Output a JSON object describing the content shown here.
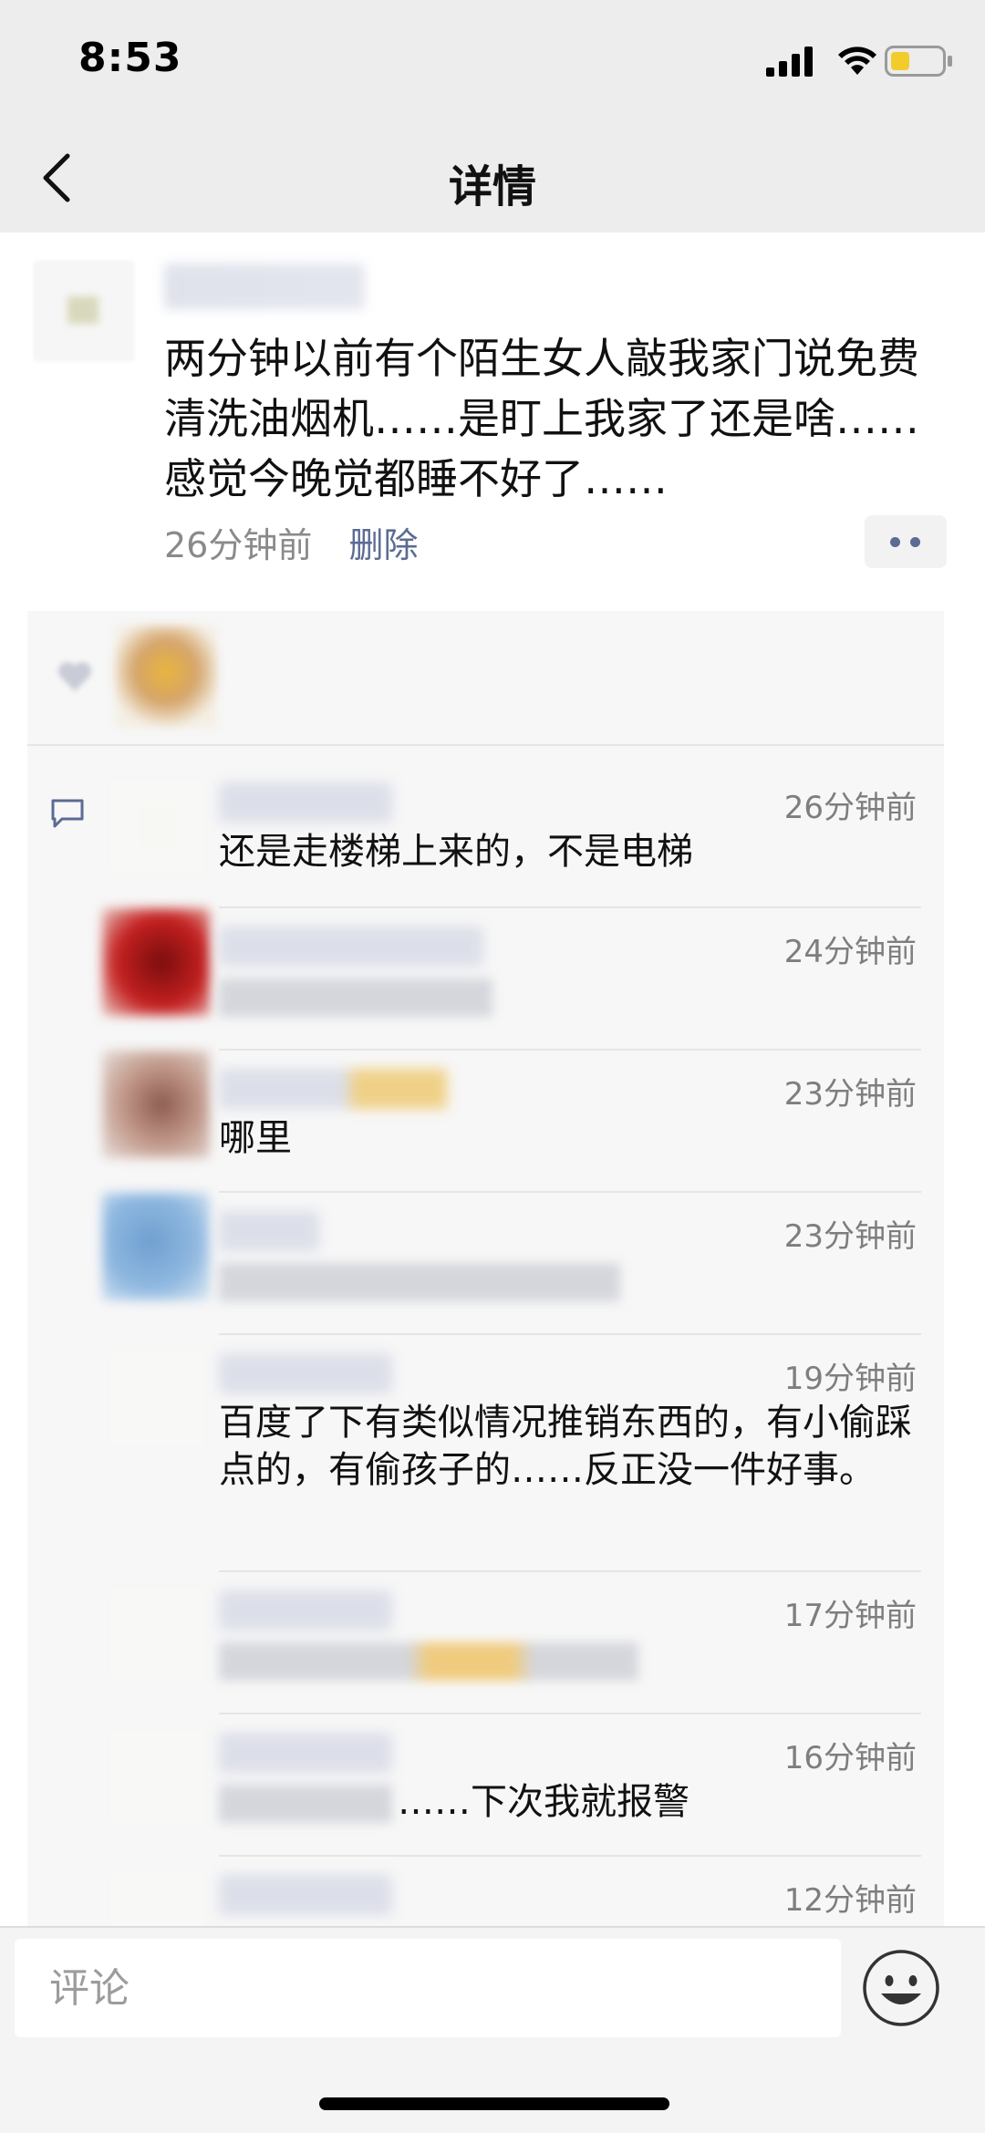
{
  "status_bar": {
    "time": "8:53"
  },
  "nav": {
    "title": "详情"
  },
  "post": {
    "text": "两分钟以前有个陌生女人敲我家门说免费清洗油烟机……是盯上我家了还是啥……感觉今晚觉都睡不好了……",
    "time": "26分钟前",
    "delete_label": "删除"
  },
  "comments": [
    {
      "time": "26分钟前",
      "text": "还是走楼梯上来的，不是电梯"
    },
    {
      "time": "24分钟前",
      "text": ""
    },
    {
      "time": "23分钟前",
      "text": "哪里"
    },
    {
      "time": "23分钟前",
      "text": ""
    },
    {
      "time": "19分钟前",
      "text": "百度了下有类似情况推销东西的，有小偷踩点的，有偷孩子的……反正没一件好事。"
    },
    {
      "time": "17分钟前",
      "text": ""
    },
    {
      "time": "16分钟前",
      "text": "……下次我就报警"
    },
    {
      "time": "12分钟前",
      "text": ""
    }
  ],
  "input": {
    "placeholder": "评论"
  },
  "colors": {
    "nav_background": "#ededed",
    "link_blue": "#5b6b93",
    "feedback_background": "#f7f7f7"
  }
}
